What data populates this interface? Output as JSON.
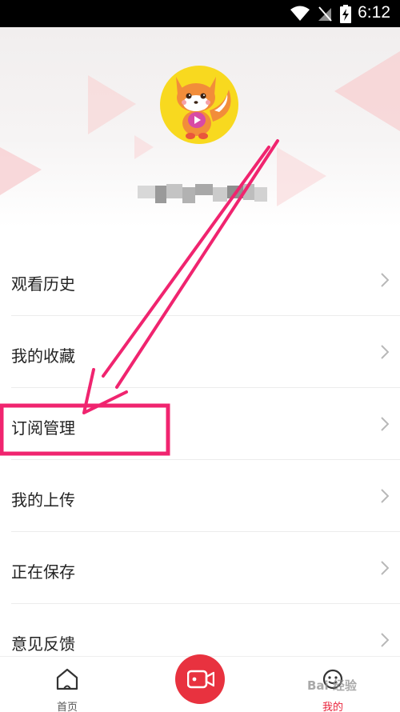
{
  "status_bar": {
    "time": "6:12",
    "icons": [
      "wifi-icon",
      "no-sim-icon",
      "battery-charging-icon"
    ]
  },
  "profile": {
    "avatar_icon": "fox-mascot-icon",
    "username": ""
  },
  "menu": {
    "items": [
      {
        "label": "观看历史",
        "icon": "chevron-right-icon"
      },
      {
        "label": "我的收藏",
        "icon": "chevron-right-icon"
      },
      {
        "label": "订阅管理",
        "icon": "chevron-right-icon"
      },
      {
        "label": "我的上传",
        "icon": "chevron-right-icon"
      },
      {
        "label": "正在保存",
        "icon": "chevron-right-icon"
      },
      {
        "label": "意见反馈",
        "icon": "chevron-right-icon"
      }
    ]
  },
  "tab_bar": {
    "home_label": "首页",
    "mine_label": "我的",
    "record_icon": "video-camera-icon",
    "active": "我的"
  },
  "colors": {
    "accent": "#e8323f",
    "annotation": "#f0246f",
    "avatar_bg": "#f8d91f"
  },
  "watermark": "Bai 经验"
}
